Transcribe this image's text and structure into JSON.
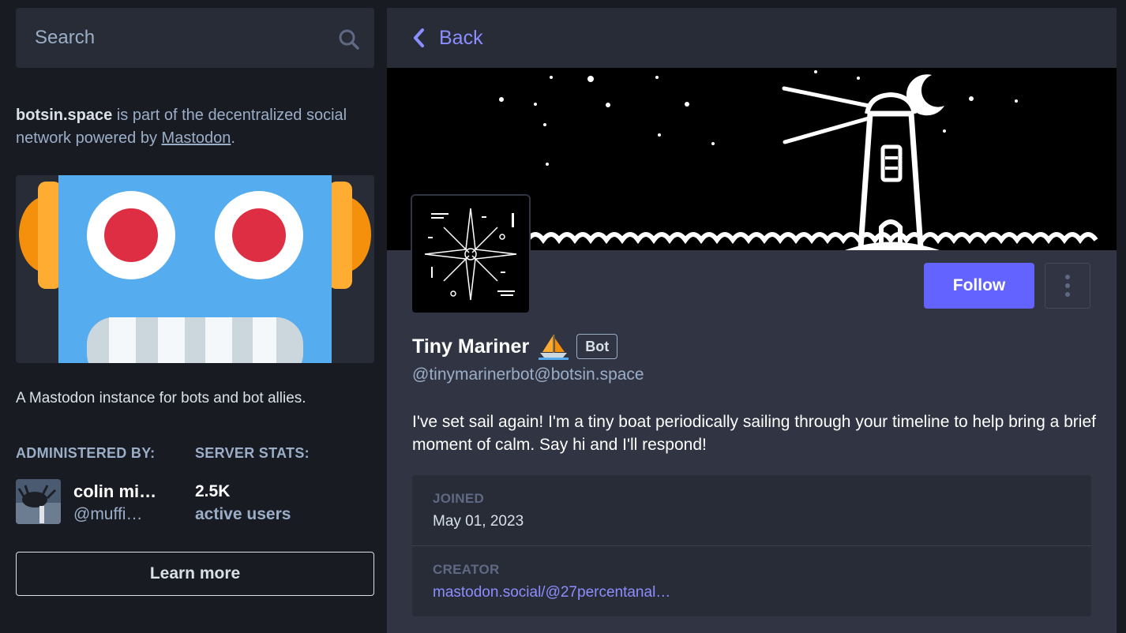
{
  "search": {
    "placeholder": "Search"
  },
  "about": {
    "server": "botsin.space",
    "text_middle": " is part of the decentralized social network powered by ",
    "link": "Mastodon",
    "text_end": "."
  },
  "description": "A Mastodon instance for bots and bot allies.",
  "admin": {
    "heading": "ADMINISTERED BY:",
    "name": "colin mi…",
    "handle": "@muffi…"
  },
  "server_stats": {
    "heading": "SERVER STATS:",
    "value": "2.5K",
    "label": "active users"
  },
  "learn_more": "Learn more",
  "nav": {
    "back": "Back"
  },
  "profile": {
    "display_name": "Tiny Mariner",
    "badge": "Bot",
    "handle": "@tinymarinerbot@botsin.space",
    "bio": "I've set sail again! I'm a tiny boat periodically sailing through your timeline to help bring a brief moment of calm. Say hi and I'll respond!",
    "follow": "Follow"
  },
  "fields": [
    {
      "label": "JOINED",
      "value": "May 01, 2023"
    },
    {
      "label": "CREATOR",
      "value": "mastodon.social/@27percentanal…"
    }
  ],
  "colors": {
    "accent": "#6364ff",
    "link": "#8c8dff",
    "background": "#191b22",
    "panel": "#282c37"
  },
  "icons": [
    "search-icon",
    "chevron-left-icon",
    "sailboat-icon",
    "kebab-menu-icon"
  ]
}
